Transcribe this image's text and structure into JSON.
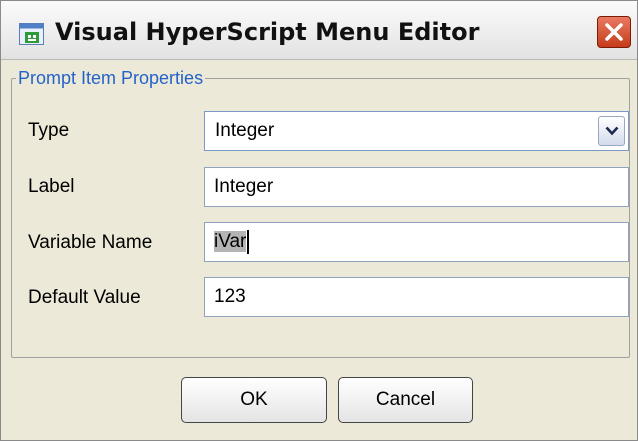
{
  "window": {
    "title": "Visual HyperScript Menu Editor"
  },
  "group": {
    "legend": "Prompt Item Properties"
  },
  "fields": {
    "type": {
      "label": "Type",
      "value": "Integer"
    },
    "label": {
      "label": "Label",
      "value": "Integer"
    },
    "variable_name": {
      "label": "Variable Name",
      "value": "iVar"
    },
    "default_value": {
      "label": "Default Value",
      "value": "123"
    }
  },
  "buttons": {
    "ok": "OK",
    "cancel": "Cancel"
  },
  "colors": {
    "legend": "#2463c9",
    "close_button": "#d04a2b",
    "selection": "#b4b4b4"
  },
  "icons": {
    "app": "app-icon",
    "close": "close-icon",
    "dropdown": "chevron-down-icon"
  }
}
